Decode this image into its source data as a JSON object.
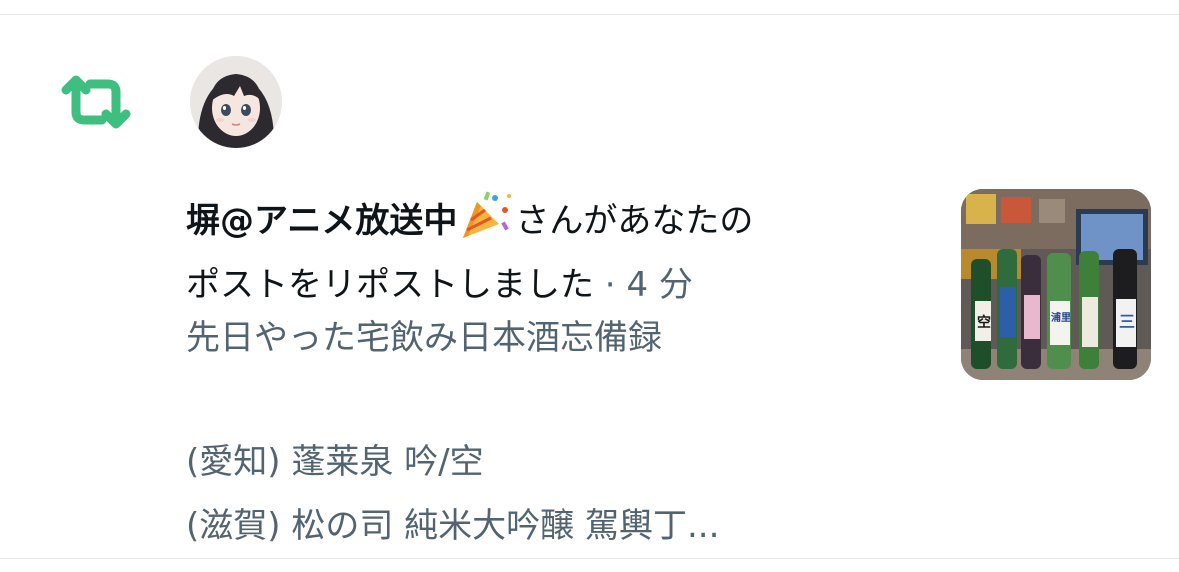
{
  "notification": {
    "user_name": "塀@アニメ放送中",
    "action_text_1": "さんがあなたの",
    "action_text_2": "ポストをリポストしました",
    "separator": " · ",
    "time": "4 分"
  },
  "post_preview": {
    "line1": "先日やった宅飲み日本酒忘備録",
    "line2": "(愛知) 蓬莱泉 吟/空",
    "line3": "(滋賀) 松の司 純米大吟醸 駕輿丁..."
  },
  "thumbnail": {
    "bottle_labels": [
      "空",
      "浦里",
      "三"
    ]
  },
  "icons": {
    "repost": "repost-icon",
    "celebration": "party-popper-icon"
  },
  "colors": {
    "repost_green": "#00ba7c",
    "text_primary": "#0f1419",
    "text_secondary": "#536471",
    "divider": "#e4e6e8"
  }
}
